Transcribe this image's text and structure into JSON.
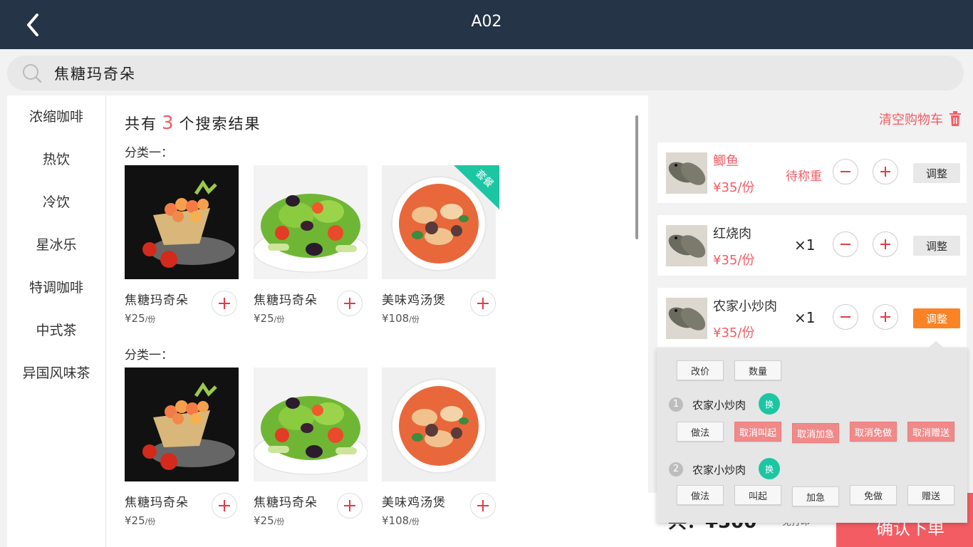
{
  "header": {
    "title": "A02"
  },
  "search": {
    "value": "焦糖玛奇朵"
  },
  "sidebar": {
    "items": [
      "浓缩咖啡",
      "热饮",
      "冷饮",
      "星冰乐",
      "特调咖啡",
      "中式茶",
      "异国风味茶"
    ]
  },
  "results": {
    "prefix": "共有",
    "count": "3",
    "suffix": "个搜索结果",
    "groups": [
      {
        "label": "分类一：",
        "products": [
          {
            "name": "焦糖玛奇朵",
            "price": "¥25",
            "unit": "/份"
          },
          {
            "name": "焦糖玛奇朵",
            "price": "¥25",
            "unit": "/份"
          },
          {
            "name": "美味鸡汤煲",
            "price": "¥108",
            "unit": "/份",
            "badge": "套餐"
          }
        ]
      },
      {
        "label": "分类一：",
        "products": [
          {
            "name": "焦糖玛奇朵",
            "price": "¥25",
            "unit": "/份"
          },
          {
            "name": "焦糖玛奇朵",
            "price": "¥25",
            "unit": "/份"
          },
          {
            "name": "美味鸡汤煲",
            "price": "¥108",
            "unit": "/份"
          }
        ]
      }
    ]
  },
  "cart": {
    "clear_label": "清空购物车",
    "items": [
      {
        "name": "鲫鱼",
        "price": "¥35/份",
        "status": "待称重",
        "adjust": "调整"
      },
      {
        "name": "红烧肉",
        "price": "¥35/份",
        "qty": "×1",
        "adjust": "调整"
      },
      {
        "name": "农家小炒肉",
        "price": "¥35/份",
        "qty": "×1",
        "adjust": "调整"
      }
    ]
  },
  "popup": {
    "top_buttons": [
      "改价",
      "数量"
    ],
    "subitems": [
      {
        "num": "1",
        "name": "农家小炒肉",
        "swap": "换",
        "buttons": [
          "做法",
          "取消叫起",
          "取消加急",
          "取消免做",
          "取消赠送"
        ]
      },
      {
        "num": "2",
        "name": "农家小炒肉",
        "swap": "换",
        "buttons": [
          "做法",
          "叫起",
          "加急",
          "免做",
          "赠送"
        ]
      }
    ]
  },
  "footer": {
    "total": "共：¥300",
    "note": "免打印",
    "confirm_label": "确认下单"
  },
  "colors": {
    "header_bg": "#253446",
    "accent_red": "#f45c63",
    "adjust_active": "#fb8225",
    "badge_teal": "#1dc6a3"
  }
}
